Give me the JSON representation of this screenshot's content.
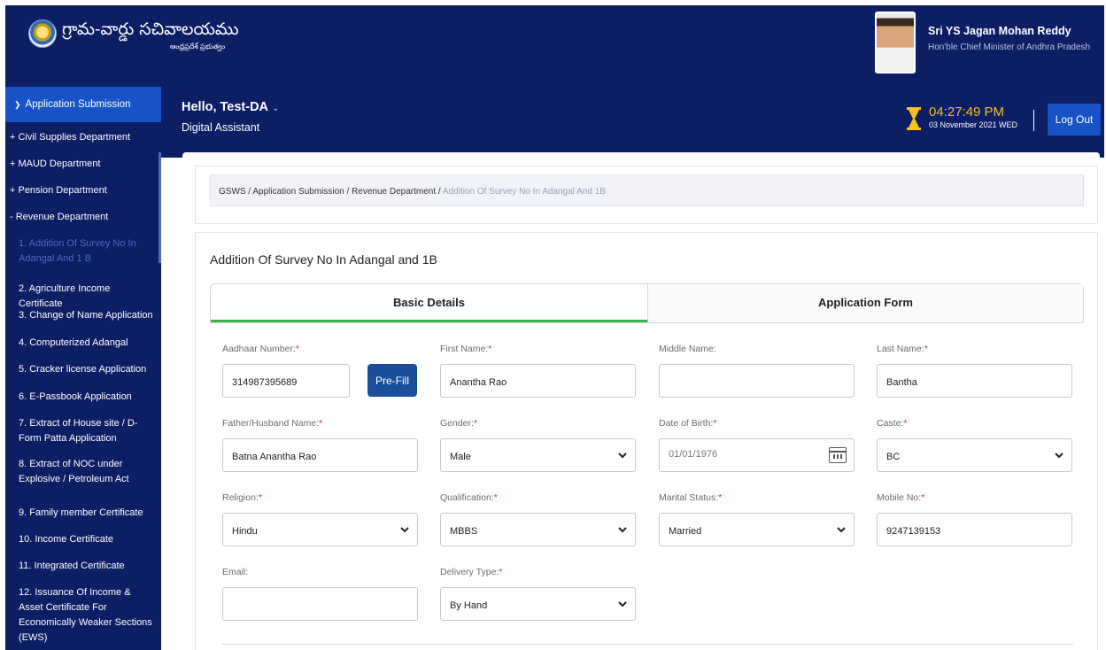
{
  "header": {
    "title": "గ్రామ-వార్డు సచివాలయము",
    "subtitle": "ఆంధ్రప్రదేశ్ ప్రభుత్వం",
    "cm_name": "Sri YS Jagan Mohan Reddy",
    "cm_title": "Hon'ble Chief Minister of Andhra Pradesh"
  },
  "user": {
    "greeting": "Hello, Test-DA",
    "dropdown": "⌄",
    "role": "Digital Assistant"
  },
  "clock": {
    "time": "04:27:49 PM",
    "date": "03 November 2021 WED"
  },
  "logout_label": "Log Out",
  "sidebar": {
    "active": "Application Submission",
    "items": [
      "+ Civil Supplies Department",
      "+ MAUD Department",
      "+ Pension Department",
      "- Revenue Department",
      "1. Addition Of Survey No In Adangal And 1 B",
      "2. Agriculture Income Certificate",
      "3. Change of Name Application",
      "4. Computerized Adangal",
      "5. Cracker license Application",
      "6. E-Passbook Application",
      "7. Extract of House site / D-Form Patta Application",
      "8. Extract of NOC under Explosive / Petroleum Act",
      "9. Family member Certificate",
      "10. Income Certificate",
      "11. Integrated Certificate",
      "12. Issuance Of Income & Asset Certificate For Economically Weaker Sections (EWS)"
    ]
  },
  "breadcrumb": {
    "path": "GSWS / Application Submission / Revenue Department /",
    "current": "Addition Of Survey No In Adangal And 1B"
  },
  "form": {
    "title": "Addition Of Survey No In Adangal and 1B",
    "tabs": [
      "Basic Details",
      "Application Form"
    ],
    "prefill_label": "Pre-Fill",
    "fields": {
      "aadhaar": {
        "label": "Aadhaar Number:",
        "value": "314987395689"
      },
      "first_name": {
        "label": "First Name:",
        "value": "Anantha Rao"
      },
      "middle_name": {
        "label": "Middle Name:",
        "value": ""
      },
      "last_name": {
        "label": "Last Name:",
        "value": "Bantha"
      },
      "father_name": {
        "label": "Father/Husband Name:",
        "value": "Batna Anantha Rao"
      },
      "gender": {
        "label": "Gender:",
        "value": "Male"
      },
      "dob": {
        "label": "Date of Birth:",
        "value": "01/01/1976"
      },
      "caste": {
        "label": "Caste:",
        "value": "BC"
      },
      "religion": {
        "label": "Religion:",
        "value": "Hindu"
      },
      "qualification": {
        "label": "Qualification:",
        "value": "MBBS"
      },
      "marital_status": {
        "label": "Marital Status:",
        "value": "Married"
      },
      "mobile": {
        "label": "Mobile No:",
        "value": "9247139153"
      },
      "email": {
        "label": "Email:",
        "value": ""
      },
      "delivery_type": {
        "label": "Delivery Type:",
        "value": "By Hand"
      }
    },
    "required_mark": "*"
  },
  "colors": {
    "navy": "#0c1e64",
    "active_blue": "#1753c6",
    "clock_gold": "#f3c21b",
    "tab_green": "#3bb24a",
    "prefill_blue": "#1a4e9b",
    "required_red": "#e0263a"
  },
  "icons": [
    "emblem-icon",
    "chevron-down-icon",
    "hourglass-icon",
    "calendar-icon"
  ]
}
